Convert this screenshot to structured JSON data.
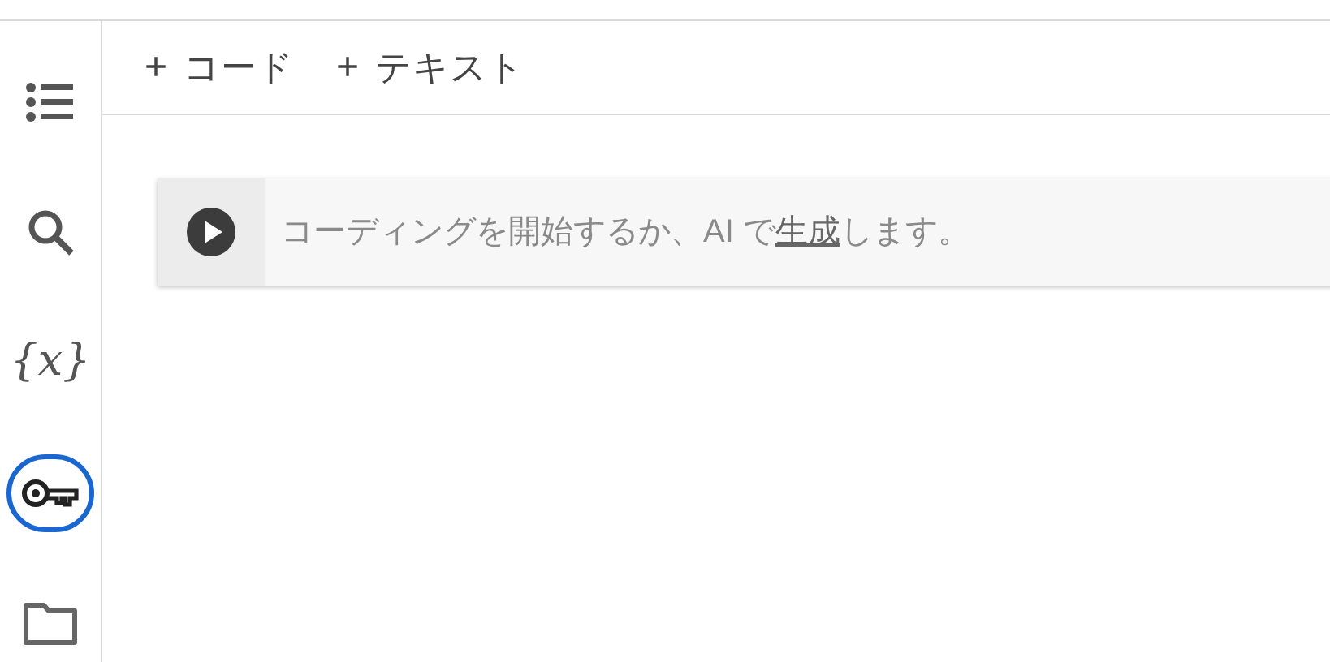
{
  "sidebar": {
    "items": [
      {
        "kind": "toc",
        "selected": false
      },
      {
        "kind": "search",
        "selected": false
      },
      {
        "kind": "variables",
        "glyph": "{x}",
        "selected": false
      },
      {
        "kind": "secrets",
        "selected": true
      },
      {
        "kind": "files",
        "selected": false
      }
    ]
  },
  "toolbar": {
    "buttons": [
      {
        "icon": "+",
        "label": "コード"
      },
      {
        "icon": "+",
        "label": "テキスト"
      }
    ]
  },
  "cell": {
    "placeholder_before": "コーディングを開始するか、AI で",
    "link": "生成",
    "placeholder_after": "します。"
  }
}
